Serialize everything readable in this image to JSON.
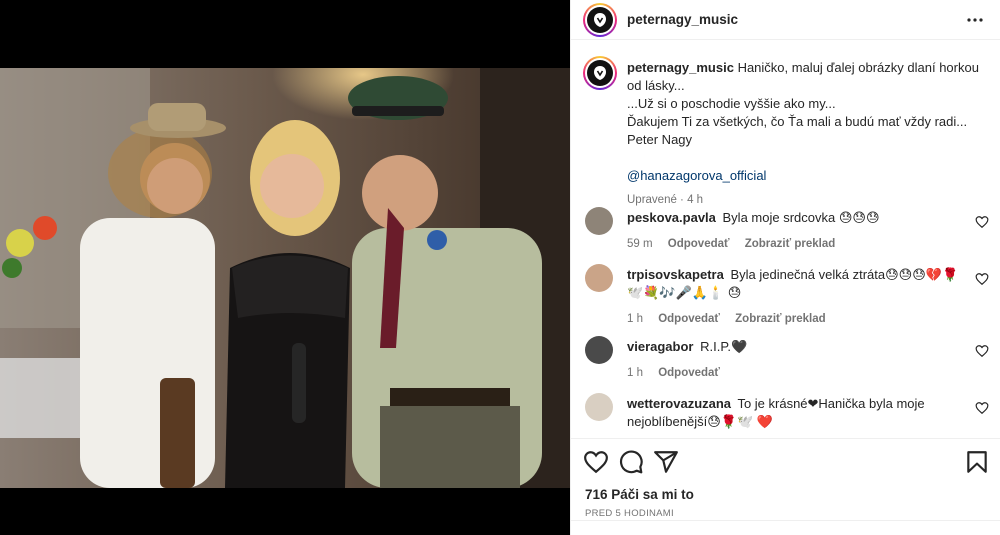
{
  "post": {
    "username": "peternagy_music",
    "avatar_icon": "peter-nagy-logo-icon",
    "more_icon": "more-horizontal-icon"
  },
  "caption": {
    "username": "peternagy_music",
    "lines": [
      "Haničko, maluj ďalej obrázky dlaní horkou od lásky...",
      "...Už si o poschodie vyššie ako my...",
      "Ďakujem Ti za všetkých, čo Ťa mali a budú mať vždy radi...",
      "Peter Nagy"
    ],
    "mention": "@hanazagorova_official",
    "edited": "Upravené · 4 h"
  },
  "comments": [
    {
      "username": "peskova.pavla",
      "text": "Byla moje srdcovka 😓😓😓",
      "time": "59 m",
      "reply": "Odpovedať",
      "translate": "Zobraziť preklad"
    },
    {
      "username": "trpisovskapetra",
      "text": "Byla jedinečná velká ztráta😓😓😓💔🌹🕊️💐🎶🎤🙏🕯️ 😓",
      "time": "1 h",
      "reply": "Odpovedať",
      "translate": "Zobraziť preklad"
    },
    {
      "username": "vieragabor",
      "text": "R.I.P.🖤",
      "time": "1 h",
      "reply": "Odpovedať",
      "translate": ""
    },
    {
      "username": "wetterovazuzana",
      "text": "To je krásné❤Hanička byla moje nejoblíbenější😓🌹🕊️ ❤️",
      "time": "",
      "reply": "",
      "translate": ""
    }
  ],
  "actions": {
    "likes": "716 Páči sa mi to",
    "posted": "PRED 5 HODINAMI",
    "icons": [
      "heart-icon",
      "comment-icon",
      "share-icon",
      "bookmark-icon"
    ]
  },
  "colors": {
    "link": "#00376b",
    "muted": "#737373",
    "text": "#262626",
    "border": "#efefef"
  }
}
